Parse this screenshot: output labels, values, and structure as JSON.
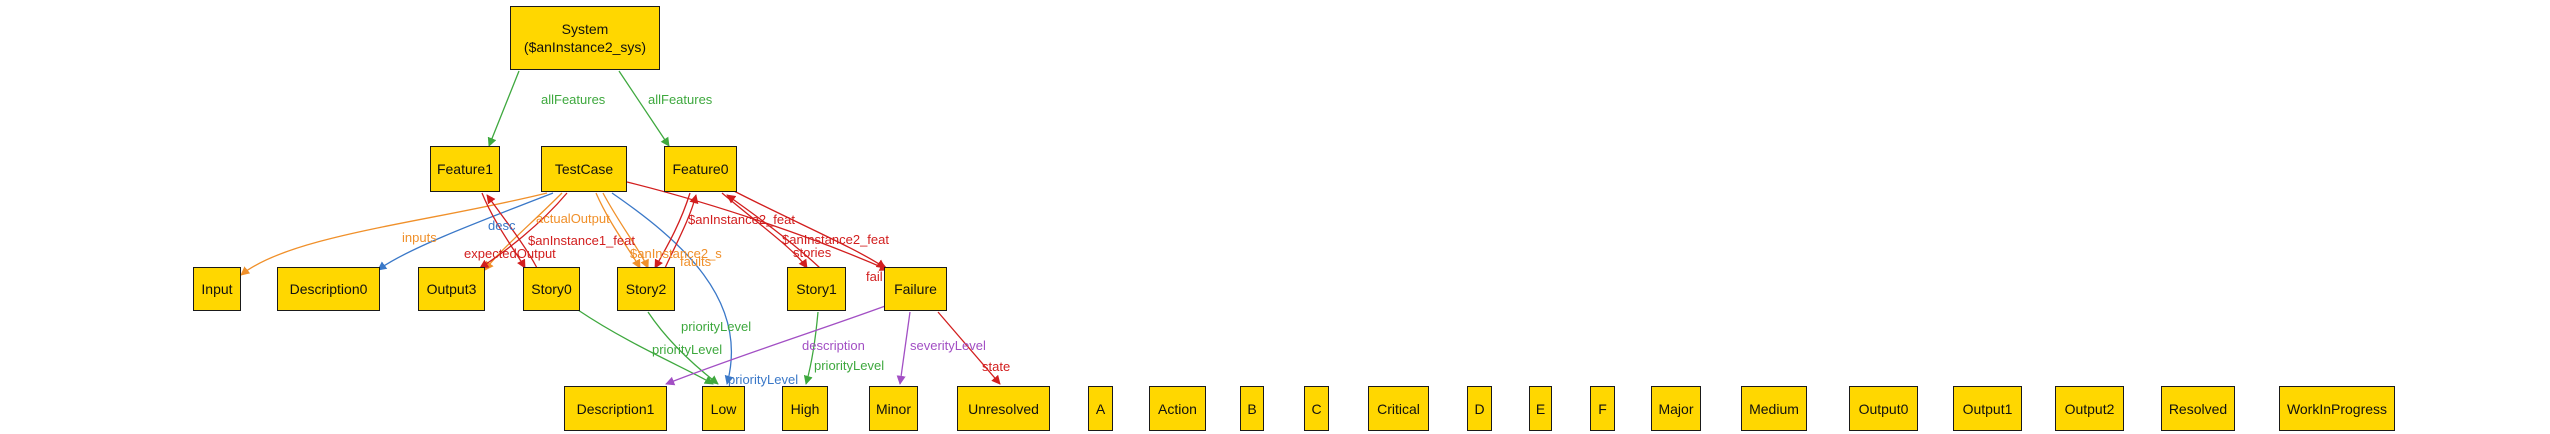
{
  "colors": {
    "node_fill": "#ffd700",
    "node_border": "#1a1a1a",
    "green": "#3ea83e",
    "orange": "#f0902a",
    "red": "#d21e1e",
    "blue": "#3a78c8",
    "purple": "#a24fc4"
  },
  "nodes": {
    "system": {
      "line1": "System",
      "line2": "($anInstance2_sys)"
    },
    "feature1": "Feature1",
    "testcase": "TestCase",
    "feature0": "Feature0",
    "input": "Input",
    "description0": "Description0",
    "output3": "Output3",
    "story0": "Story0",
    "story2": "Story2",
    "story1": "Story1",
    "failure": "Failure",
    "description1": "Description1",
    "low": "Low",
    "high": "High",
    "minor": "Minor",
    "unresolved": "Unresolved",
    "a": "A",
    "action": "Action",
    "b": "B",
    "c": "C",
    "critical": "Critical",
    "d": "D",
    "e": "E",
    "f": "F",
    "major": "Major",
    "medium": "Medium",
    "output0": "Output0",
    "output1": "Output1",
    "output2": "Output2",
    "resolved": "Resolved",
    "workinprogress": "WorkInProgress"
  },
  "edge_labels": {
    "allFeatures_left": "allFeatures",
    "allFeatures_right": "allFeatures",
    "inputs": "inputs",
    "desc": "desc",
    "actualOutput": "actualOutput",
    "expectedOutput": "expectedOutput",
    "anInstance1_feat": "$anInstance1_feat",
    "anInstance2_s": "$anInstance2_s",
    "s_faults": "faults",
    "anInstance2_feat_a": "$anInstance2_feat",
    "anInstance2_feat_b": "$anInstance2_feat",
    "stories": "stories",
    "fail": "fail",
    "priorityLevel_story2": "priorityLevel",
    "priorityLevel_story0": "priorityLevel",
    "priorityLevel_testcase": "priorityLevel",
    "priorityLevel_story1": "priorityLevel",
    "description": "description",
    "severityLevel": "severityLevel",
    "state": "state"
  }
}
